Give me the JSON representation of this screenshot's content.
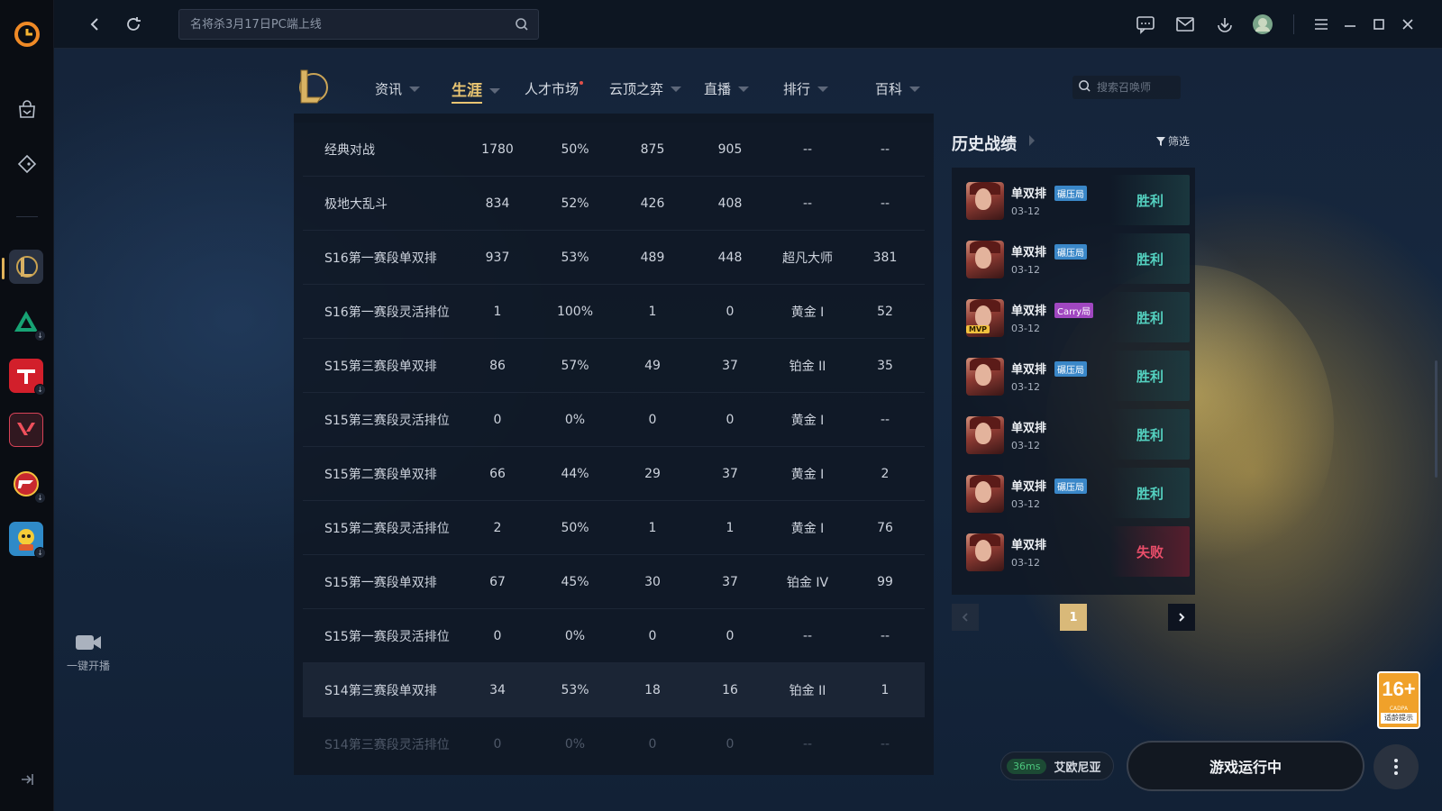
{
  "topbar": {
    "search_placeholder": "名将杀3月17日PC端上线"
  },
  "game_nav": {
    "tabs": [
      {
        "label": "资讯",
        "caret": true
      },
      {
        "label": "生涯",
        "caret": true,
        "active": true
      },
      {
        "label": "人才市场",
        "caret": false,
        "dot": true
      },
      {
        "label": "云顶之弈",
        "caret": true
      },
      {
        "label": "直播",
        "caret": true
      },
      {
        "label": "排行",
        "caret": true
      },
      {
        "label": "百科",
        "caret": true
      }
    ],
    "summoner_search_placeholder": "搜索召唤师"
  },
  "stats_table": {
    "rows": [
      [
        "经典对战",
        "1780",
        "50%",
        "875",
        "905",
        "--",
        "--"
      ],
      [
        "极地大乱斗",
        "834",
        "52%",
        "426",
        "408",
        "--",
        "--"
      ],
      [
        "S16第一赛段单双排",
        "937",
        "53%",
        "489",
        "448",
        "超凡大师",
        "381"
      ],
      [
        "S16第一赛段灵活排位",
        "1",
        "100%",
        "1",
        "0",
        "黄金 I",
        "52"
      ],
      [
        "S15第三赛段单双排",
        "86",
        "57%",
        "49",
        "37",
        "铂金 II",
        "35"
      ],
      [
        "S15第三赛段灵活排位",
        "0",
        "0%",
        "0",
        "0",
        "黄金 I",
        "--"
      ],
      [
        "S15第二赛段单双排",
        "66",
        "44%",
        "29",
        "37",
        "黄金 I",
        "2"
      ],
      [
        "S15第二赛段灵活排位",
        "2",
        "50%",
        "1",
        "1",
        "黄金 I",
        "76"
      ],
      [
        "S15第一赛段单双排",
        "67",
        "45%",
        "30",
        "37",
        "铂金 IV",
        "99"
      ],
      [
        "S15第一赛段灵活排位",
        "0",
        "0%",
        "0",
        "0",
        "--",
        "--"
      ],
      [
        "S14第三赛段单双排",
        "34",
        "53%",
        "18",
        "16",
        "铂金 II",
        "1"
      ],
      [
        "S14第三赛段灵活排位",
        "0",
        "0%",
        "0",
        "0",
        "--",
        "--"
      ]
    ]
  },
  "history": {
    "title": "历史战绩",
    "filter_label": "筛选",
    "matches": [
      {
        "mode": "单双排",
        "tag": "碾压局",
        "tag_color": "#3a87c8",
        "date": "03-12",
        "result": "胜利",
        "win": true,
        "mvp": false
      },
      {
        "mode": "单双排",
        "tag": "碾压局",
        "tag_color": "#3a87c8",
        "date": "03-12",
        "result": "胜利",
        "win": true,
        "mvp": false
      },
      {
        "mode": "单双排",
        "tag": "Carry局",
        "tag_color": "#a047c0",
        "date": "03-12",
        "result": "胜利",
        "win": true,
        "mvp": true
      },
      {
        "mode": "单双排",
        "tag": "碾压局",
        "tag_color": "#3a87c8",
        "date": "03-12",
        "result": "胜利",
        "win": true,
        "mvp": false
      },
      {
        "mode": "单双排",
        "tag": "",
        "tag_color": "",
        "date": "03-12",
        "result": "胜利",
        "win": true,
        "mvp": false
      },
      {
        "mode": "单双排",
        "tag": "碾压局",
        "tag_color": "#3a87c8",
        "date": "03-12",
        "result": "胜利",
        "win": true,
        "mvp": false
      },
      {
        "mode": "单双排",
        "tag": "",
        "tag_color": "",
        "date": "03-12",
        "result": "失败",
        "win": false,
        "mvp": false
      }
    ],
    "mvp_label": "MVP",
    "pager": {
      "current_page": "1"
    }
  },
  "sidebar": {
    "go_live_label": "一键开播"
  },
  "footer": {
    "ping": "36ms",
    "server_name": "艾欧尼亚",
    "launch_label": "游戏运行中"
  },
  "age_badge": {
    "age": "16+",
    "org": "CADPA",
    "note": "适龄提示"
  },
  "colors": {
    "accent_gold": "#e9c572",
    "win": "#54d1c0",
    "loss": "#ea4e6a"
  }
}
